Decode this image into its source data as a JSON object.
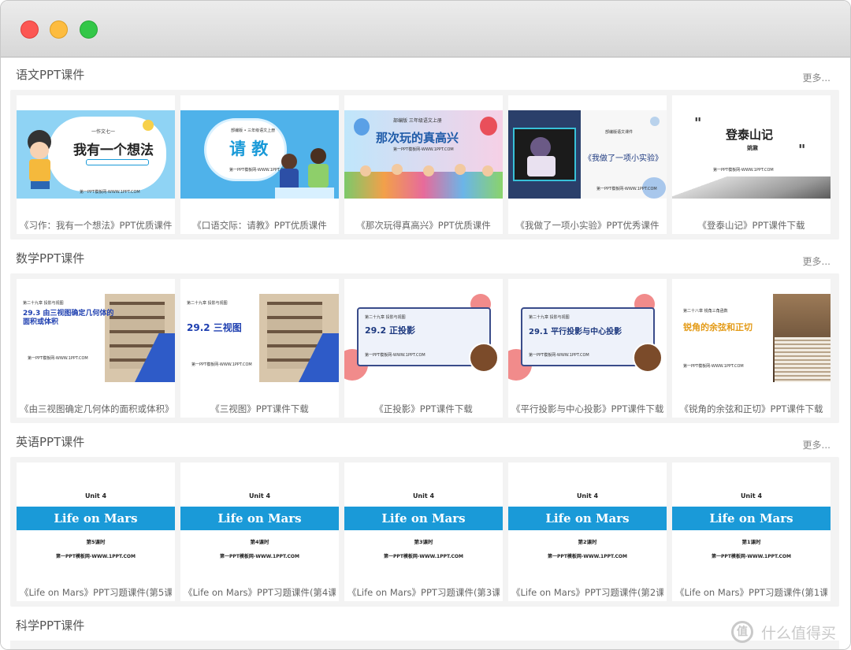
{
  "sections": [
    {
      "title": "语文PPT课件",
      "more": "更多...",
      "cards": [
        {
          "caption": "《习作：我有一个想法》PPT优质课件",
          "thumb_title": "我有一个想法",
          "thumb_sub": "一作文七一",
          "thumb_site": "第一PPT模板网-WWW.1PPT.COM"
        },
        {
          "caption": "《口语交际：请教》PPT优质课件",
          "thumb_title": "请 教",
          "thumb_sub": "部编版 • 三年级语文上册",
          "thumb_site": "第一PPT模板网-WWW.1PPT.COM"
        },
        {
          "caption": "《那次玩得真高兴》PPT优质课件",
          "thumb_title": "那次玩的真高兴",
          "thumb_sub": "部编版    三年级语文上册",
          "thumb_site": "第一PPT模板网-WWW.1PPT.COM"
        },
        {
          "caption": "《我做了一项小实验》PPT优秀课件",
          "thumb_title": "《我做了一项小实验》",
          "thumb_sub": "部编版语文课件",
          "thumb_site": "第一PPT模板网-WWW.1PPT.COM"
        },
        {
          "caption": "《登泰山记》PPT课件下载",
          "thumb_title": "登泰山记",
          "thumb_sub": "姚鼐",
          "thumb_site": "第一PPT模板网-WWW.1PPT.COM"
        }
      ]
    },
    {
      "title": "数学PPT课件",
      "more": "更多...",
      "cards": [
        {
          "caption": "《由三视图确定几何体的面积或体积》",
          "thumb_title": "29.3 由三视图确定几何体的面积或体积",
          "thumb_sub": "第二十九章 投影与视图",
          "thumb_site": "第一PPT模板网-WWW.1PPT.COM"
        },
        {
          "caption": "《三视图》PPT课件下载",
          "thumb_title": "29.2 三视图",
          "thumb_sub": "第二十九章 投影与视图",
          "thumb_site": "第一PPT模板网-WWW.1PPT.COM"
        },
        {
          "caption": "《正投影》PPT课件下载",
          "thumb_title": "29.2 正投影",
          "thumb_sub": "第二十九章 投影与视图",
          "thumb_site": "第一PPT模板网-WWW.1PPT.COM"
        },
        {
          "caption": "《平行投影与中心投影》PPT课件下载",
          "thumb_title": "29.1 平行投影与中心投影",
          "thumb_sub": "第二十九章 投影与视图",
          "thumb_site": "第一PPT模板网-WWW.1PPT.COM"
        },
        {
          "caption": "《锐角的余弦和正切》PPT课件下载",
          "thumb_title": "锐角的余弦和正切",
          "thumb_sub": "第二十八章 锐角三角函数",
          "thumb_site": "第一PPT模板网-WWW.1PPT.COM"
        }
      ]
    },
    {
      "title": "英语PPT课件",
      "more": "更多...",
      "cards": [
        {
          "caption": "《Life on Mars》PPT习题课件(第5课",
          "unit": "Unit 4",
          "life": "Life on Mars",
          "lesson": "第5课时",
          "thumb_site": "第一PPT模板网-WWW.1PPT.COM"
        },
        {
          "caption": "《Life on Mars》PPT习题课件(第4课",
          "unit": "Unit 4",
          "life": "Life on Mars",
          "lesson": "第4课时",
          "thumb_site": "第一PPT模板网-WWW.1PPT.COM"
        },
        {
          "caption": "《Life on Mars》PPT习题课件(第3课",
          "unit": "Unit 4",
          "life": "Life on Mars",
          "lesson": "第3课时",
          "thumb_site": "第一PPT模板网-WWW.1PPT.COM"
        },
        {
          "caption": "《Life on Mars》PPT习题课件(第2课",
          "unit": "Unit 4",
          "life": "Life on Mars",
          "lesson": "第2课时",
          "thumb_site": "第一PPT模板网-WWW.1PPT.COM"
        },
        {
          "caption": "《Life on Mars》PPT习题课件(第1课",
          "unit": "Unit 4",
          "life": "Life on Mars",
          "lesson": "第1课时",
          "thumb_site": "第一PPT模板网-WWW.1PPT.COM"
        }
      ]
    },
    {
      "title": "科学PPT课件"
    }
  ],
  "watermark": {
    "icon": "值",
    "text": "什么值得买"
  },
  "colors": {
    "accent_blue": "#1a9ad8",
    "close": "#fc5753",
    "minimize": "#fdbc40",
    "zoom": "#33c748"
  }
}
